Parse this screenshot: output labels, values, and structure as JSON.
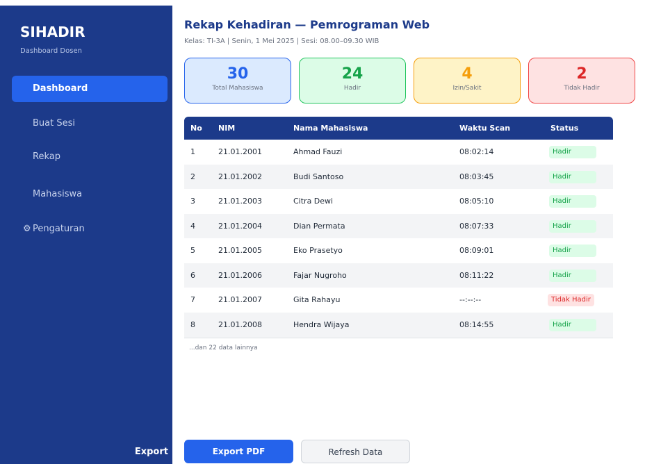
{
  "sidebar": {
    "brand": "SIHADIR",
    "brand_sub": "Dashboard Dosen",
    "items": [
      {
        "icon": "",
        "label": "Dashboard"
      },
      {
        "icon": "",
        "label": "Buat Sesi"
      },
      {
        "icon": "",
        "label": "Rekap"
      },
      {
        "icon": "",
        "label": "Mahasiswa"
      },
      {
        "icon": "⚙",
        "label": "Pengaturan"
      }
    ],
    "footer_label": "Export"
  },
  "header": {
    "title": "Rekap Kehadiran — Pemrograman Web",
    "subtitle": "Kelas: TI-3A  |  Senin, 1 Mei 2025  |  Sesi: 08.00–09.30 WIB"
  },
  "stats": [
    {
      "value": "30",
      "label": "Total Mahasiswa",
      "color": "#2563eb",
      "bg": "#dbeafe",
      "border": "#2563eb"
    },
    {
      "value": "24",
      "label": "Hadir",
      "color": "#16a34a",
      "bg": "#dcfce7",
      "border": "#22c55e"
    },
    {
      "value": "4",
      "label": "Izin/Sakit",
      "color": "#f59e0b",
      "bg": "#fef3c7",
      "border": "#f59e0b"
    },
    {
      "value": "2",
      "label": "Tidak Hadir",
      "color": "#dc2626",
      "bg": "#fee2e2",
      "border": "#ef4444"
    }
  ],
  "table": {
    "headers": [
      "No",
      "NIM",
      "Nama Mahasiswa",
      "Waktu Scan",
      "Status"
    ],
    "rows": [
      {
        "no": "1",
        "nim": "21.01.2001",
        "name": "Ahmad Fauzi",
        "time": "08:02:14",
        "status": "Hadir"
      },
      {
        "no": "2",
        "nim": "21.01.2002",
        "name": "Budi Santoso",
        "time": "08:03:45",
        "status": "Hadir"
      },
      {
        "no": "3",
        "nim": "21.01.2003",
        "name": "Citra Dewi",
        "time": "08:05:10",
        "status": "Hadir"
      },
      {
        "no": "4",
        "nim": "21.01.2004",
        "name": "Dian Permata",
        "time": "08:07:33",
        "status": "Hadir"
      },
      {
        "no": "5",
        "nim": "21.01.2005",
        "name": "Eko Prasetyo",
        "time": "08:09:01",
        "status": "Hadir"
      },
      {
        "no": "6",
        "nim": "21.01.2006",
        "name": "Fajar Nugroho",
        "time": "08:11:22",
        "status": "Hadir"
      },
      {
        "no": "7",
        "nim": "21.01.2007",
        "name": "Gita Rahayu",
        "time": "--:--:--",
        "status": "Tidak Hadir"
      },
      {
        "no": "8",
        "nim": "21.01.2008",
        "name": "Hendra Wijaya",
        "time": "08:14:55",
        "status": "Hadir"
      }
    ],
    "more_text": "...dan 22 data lainnya"
  },
  "buttons": {
    "export": "Export PDF",
    "refresh": "Refresh Data"
  }
}
